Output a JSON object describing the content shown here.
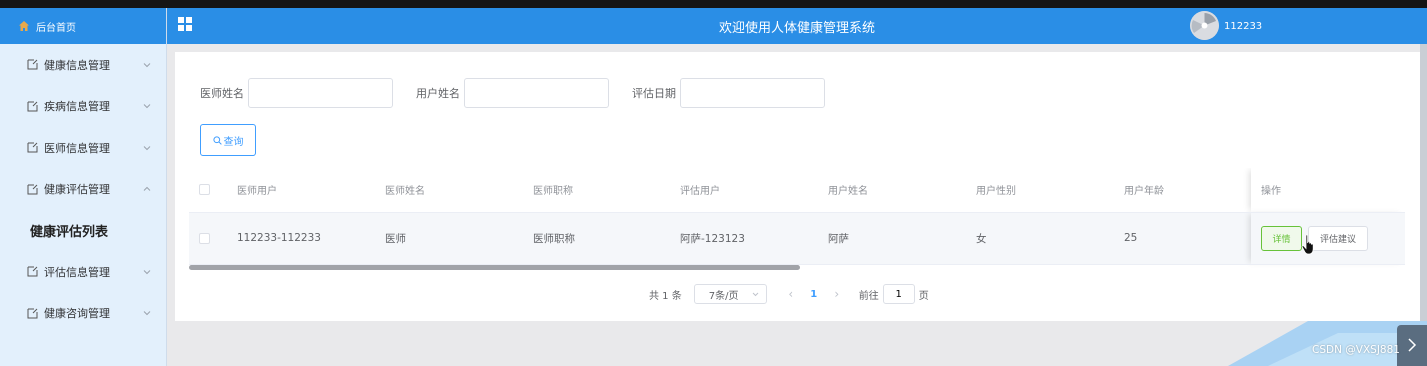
{
  "sidebar": {
    "home_label": "后台首页",
    "items": [
      {
        "label": "健康信息管理",
        "expanded": false
      },
      {
        "label": "疾病信息管理",
        "expanded": false
      },
      {
        "label": "医师信息管理",
        "expanded": false
      },
      {
        "label": "健康评估管理",
        "expanded": true
      }
    ],
    "active_sub": "健康评估列表",
    "items_after": [
      {
        "label": "评估信息管理",
        "expanded": false
      },
      {
        "label": "健康咨询管理",
        "expanded": false
      }
    ]
  },
  "header": {
    "title": "欢迎使用人体健康管理系统",
    "username": "112233"
  },
  "search": {
    "doctor_name_label": "医师姓名",
    "doctor_name_value": "",
    "user_name_label": "用户姓名",
    "user_name_value": "",
    "eval_date_label": "评估日期",
    "eval_date_value": "",
    "query_label": "查询"
  },
  "table": {
    "headers": [
      "医师用户",
      "医师姓名",
      "医师职称",
      "评估用户",
      "用户姓名",
      "用户性别",
      "用户年龄",
      "操作"
    ],
    "rows": [
      {
        "doctor_user": "112233-112233",
        "doctor_name": "医师",
        "doctor_title": "医师职称",
        "eval_user": "阿萨-123123",
        "user_name": "阿萨",
        "user_gender": "女",
        "user_age": "25",
        "detail_label": "详情",
        "advice_label": "评估建议"
      }
    ]
  },
  "pagination": {
    "total": "共 1 条",
    "page_size": "7条/页",
    "current_page": "1",
    "goto_label": "前往",
    "goto_value": "1",
    "page_suffix": "页"
  },
  "watermark": "CSDN @VXSJ881",
  "colors": {
    "primary": "#2a8ee6",
    "link": "#409eff",
    "success": "#67c23a"
  }
}
